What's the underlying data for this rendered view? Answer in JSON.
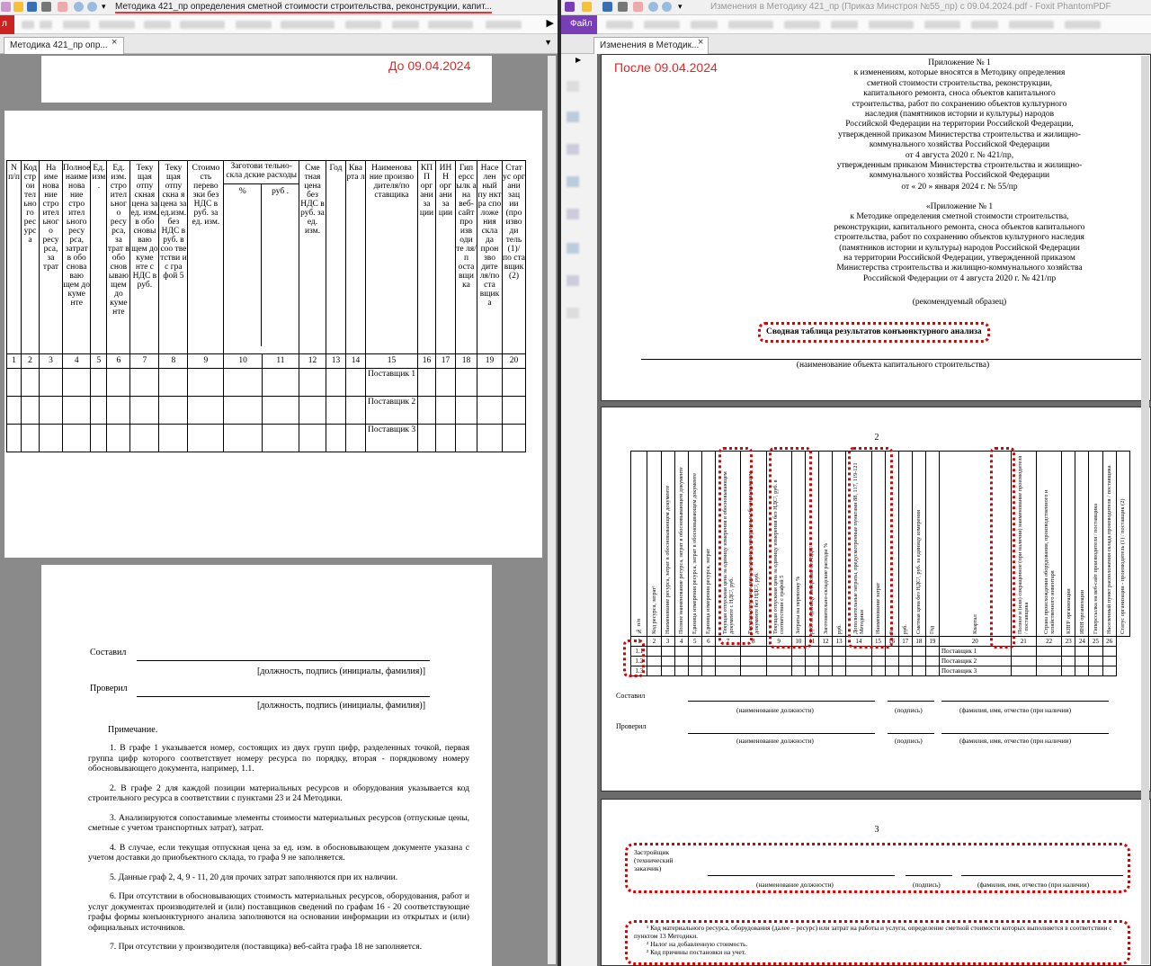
{
  "left": {
    "window_title": "Методика 421_пр определения сметной стоимости строительства, реконструкции, капит...",
    "ribbon_tab": "л",
    "tab_label": "Методика 421_пр опр...",
    "tab_close": "×",
    "stamp": "До 09.04.2024",
    "headers": [
      "N п/п",
      "Код стр ои тел ьно го рес урс а",
      "На име нова ние стро ител ьног о ресу рса, за трат",
      "Полное наиме нова ние стро ител ьного ресу рса, затрат в обо снова ваю щем до куме нте",
      "Ед. изм .",
      "Ед. изм. стро ител ьног о ресу рса, за трат в обо снов ываю щем до куме нте",
      "Теку щая отпу скная цена за ед. изм. в обо сновы ваю щем до куме нте с НДС в руб.",
      "Теку щая отпу скна я цена за ед.изм. без НДС в руб. в соо тве тстви и с гра фой 5",
      "Стоимо сть перево зки без НДС в руб. за ед. изм.",
      "Заготови тельно-скла дские расходы",
      "Сме тная цена без НДС в руб. за ед. изм.",
      "Год",
      "Ква рта л",
      "Наименова ние произво дителя/по ставщика",
      "КП П орг ани за ции",
      "ИН Н орг ани за ции",
      "Гип ерсс ылк а на веб- сайт про изв оди те ля/п оста вщи ка",
      "Насе лен ный пу нкт ра спо ложе ния скла да прон зво дите ля/по ста вщик а",
      "Стат ус орг ани зац ии (про изво ди тель (1)/ по ста вщик (2)"
    ],
    "sub_headers": [
      "%",
      "руб ."
    ],
    "nums": [
      "1",
      "2",
      "3",
      "4",
      "5",
      "6",
      "7",
      "8",
      "9",
      "10",
      "11",
      "12",
      "13",
      "14",
      "15",
      "16",
      "17",
      "18",
      "19",
      "20"
    ],
    "suppliers": [
      "Поставщик 1",
      "Поставщик 2",
      "Поставщик 3"
    ],
    "compiled": "Составил",
    "checked": "Проверил",
    "sign_hint": "[должность, подпись (инициалы, фамилия)]",
    "note_title": "Примечание.",
    "notes": [
      "1. В графе 1 указывается номер, состоящих из двух групп цифр, разделенных точкой, первая группа цифр которого соответствует номеру ресурса по порядку, вторая - порядковому номеру обосновывающего документа, например, 1.1.",
      "2. В графе 2 для каждой позиции материальных ресурсов и оборудования указывается код строительного ресурса в соответствии с пунктами 23 и 24 Методики.",
      "3. Анализируются сопоставимые элементы стоимости материальных ресурсов (отпускные цены, сметные с учетом транспортных затрат), затрат.",
      "4. В случае, если текущая отпускная цена за ед. изм. в обосновывающем документе указана с учетом доставки до приобъектного склада, то графа 9 не заполняется.",
      "5. Данные граф 2, 4, 9 - 11, 20 для прочих затрат заполняются при их наличии.",
      "6. При отсутствии в обосновывающих стоимость материальных ресурсов, оборудования, работ и услуг документах производителей и (или) поставщиков сведений по графам 16 - 20 соответствующие графы формы конъюнктурного анализа заполняются на основании информации из открытых и (или) официальных источников.",
      "7. При отсутствии у производителя (поставщика) веб-сайта графа 18 не заполняется."
    ]
  },
  "right": {
    "window_title": "Изменения в Методику 421_пр (Приказ Минстроя №55_пр) с 09.04.2024.pdf - Foxit PhantomPDF",
    "file_tab": "Файл",
    "tab_label": "Изменения в Методик...",
    "tab_close": "×",
    "stamp": "После 09.04.2024",
    "appendix_lines": [
      "Приложение № 1",
      "к изменениям, которые вносятся в Методику определения",
      "сметной стоимости строительства, реконструкции,",
      "капитального ремонта, сноса объектов капитального",
      "строительства, работ по сохранению объектов культурного",
      "наследия (памятников истории и культуры) народов",
      "Российской Федерации на территории Российской Федерации,",
      "утвержденной приказом Министерства строительства и жилищно-",
      "коммунального хозяйства Российской Федерации",
      "от 4 августа 2020 г. № 421/пр,",
      "утвержденным приказом Министерства строительства и жилищно-",
      "коммунального хозяйства Российской Федерации"
    ],
    "order_date": "от « 20 » января 2024 г. № 55/пр",
    "appendix2_lines": [
      "«Приложение № 1",
      "к Методике определения сметной стоимости строительства,",
      "реконструкции, капитального ремонта, сноса объектов капитального",
      "строительства, работ по сохранению объектов культурного наследия",
      "(памятников истории и культуры) народов Российской Федерации",
      "на территории Российской Федерации, утвержденной приказом",
      "Министерства строительства и жилищно-коммунального хозяйства",
      "Российской Федерации от 4 августа 2020 г. № 421/пр"
    ],
    "recommended": "(рекомендуемый образец)",
    "table_title": "Сводная таблица результатов конъюнктурного анализа",
    "object_hint": "(наименование объекта капитального строительства)",
    "page2_num": "2",
    "page3_num": "3",
    "vheaders": [
      "№ п/п",
      "Код ресурса, затрат¹",
      "Наименование ресурса, затрат в обосновывающем документе",
      "Полное наименование ресурса, затрат в обосновывающем документе",
      "Единица измерения ресурса, затрат в обосновывающем документе",
      "Единица измерения ресурса, затрат",
      "Текущая отпускная цена за единицу измерения в обосновывающем документе с НДС², руб.",
      "Текущая отпускная цена за единицу измерения в обосновывающем документе без НДС², руб.",
      "Текущая отпускная цена за единицу измерения без НДС², руб. в соответствии с графой 5",
      "Затраты на перевозку %",
      "руб. за единицу измерения без НДС²",
      "Заготовительно-складские расходы %",
      "руб.",
      "Дополнительные затраты, предусмотренные пунктами 88, 117, 119-121 Методики",
      "Наименование затрат",
      "%",
      "руб.",
      "Сметная цена без НДС², руб. за единицу измерения",
      "Год",
      "Квартал",
      "Полное и (или) сокращенное (при наличии) наименование производителя / поставщика",
      "Страна происхождения оборудования, производственного и хозяйственного инвентаря",
      "КПП³ организации",
      "ИНН организации",
      "Гиперссылка на веб-сайт производителя / поставщика",
      "Населенный пункт расположения склада производителя / поставщика",
      "Статус организации - производитель (1) / поставщик (2)"
    ],
    "nums": [
      "1",
      "2",
      "3",
      "4",
      "5",
      "6",
      "7",
      "8",
      "9",
      "10",
      "11",
      "12",
      "13",
      "14",
      "15",
      "16",
      "17",
      "18",
      "19",
      "20",
      "21",
      "22",
      "23",
      "24",
      "25",
      "26"
    ],
    "rows": [
      "1.1",
      "1.2",
      "1.3"
    ],
    "suppliers": [
      "Поставщик 1",
      "Поставщик 2",
      "Поставщик 3"
    ],
    "compiled": "Составил",
    "checked": "Проверил",
    "pos_hint": "(наименование должности)",
    "sign_hint": "(подпись)",
    "name_hint": "(фамилия, имя, отчество (при наличии)",
    "developer": "Застройщик (технический заказчик)",
    "footnotes": [
      "¹ Код материального ресурса, оборудования (далее – ресурс) или затрат на работы и услуги, определение сметной стоимости которых выполняется в соответствии с пунктом 13 Методики.",
      "² Налог на добавленную стоимость.",
      "³ Код причины постановки на учет."
    ]
  },
  "colors": {
    "accent_red": "#e22222",
    "foxit_purple": "#7a3db8"
  }
}
